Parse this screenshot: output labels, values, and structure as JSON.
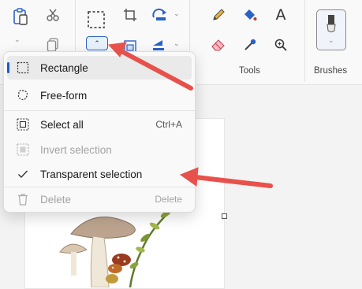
{
  "ribbon": {
    "groups": {
      "tools": "Tools",
      "brushes": "Brushes"
    },
    "icons": {
      "clipboard": "clipboard-icon",
      "cut": "scissors-icon",
      "copy": "copy-icon",
      "select": "rectangle-select-icon",
      "crop": "crop-icon",
      "rotate": "rotate-icon",
      "flip": "flip-icon",
      "pencil": "pencil-icon",
      "fill": "fill-bucket-icon",
      "text": "text-icon",
      "eraser": "eraser-icon",
      "picker": "color-picker-icon",
      "zoom": "magnifier-icon",
      "brush": "brush-icon"
    },
    "text_icon_glyph": "A"
  },
  "selection_menu": {
    "items": [
      {
        "label": "Rectangle",
        "icon": "rectangle-select-icon",
        "selected": true
      },
      {
        "label": "Free-form",
        "icon": "freeform-select-icon"
      }
    ],
    "actions": [
      {
        "label": "Select all",
        "shortcut": "Ctrl+A",
        "icon": "select-all-icon",
        "disabled": false
      },
      {
        "label": "Invert selection",
        "icon": "invert-selection-icon",
        "disabled": true
      },
      {
        "label": "Transparent selection",
        "icon": "checkmark-icon",
        "checked": true
      },
      {
        "label": "Delete",
        "shortcut": "Delete",
        "icon": "trash-icon",
        "disabled": true
      }
    ]
  },
  "colors": {
    "accent": "#1f58c6",
    "annotation_arrow": "#e8514b"
  }
}
